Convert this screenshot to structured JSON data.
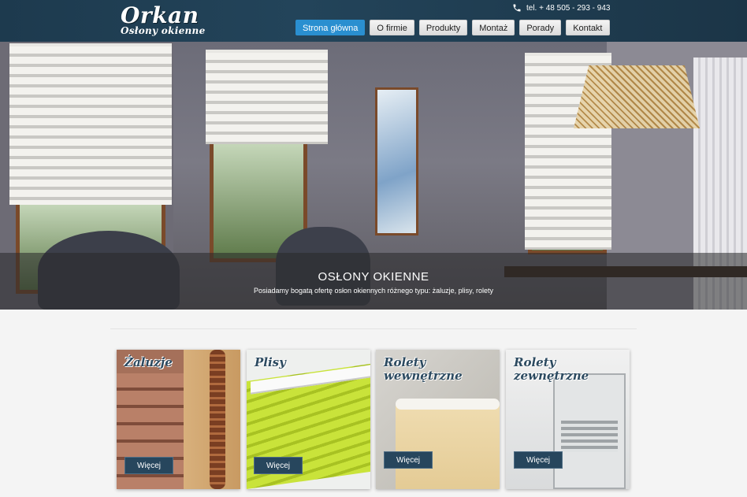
{
  "header": {
    "logo_title": "Orkan",
    "logo_subtitle": "Osłony okienne",
    "phone_label": "tel. + 48  505 - 293 - 943",
    "phone_icon": "phone-icon"
  },
  "nav": {
    "items": [
      {
        "label": "Strona główna",
        "active": true
      },
      {
        "label": "O firmie",
        "active": false
      },
      {
        "label": "Produkty",
        "active": false
      },
      {
        "label": "Montaż",
        "active": false
      },
      {
        "label": "Porady",
        "active": false
      },
      {
        "label": "Kontakt",
        "active": false
      }
    ]
  },
  "hero": {
    "title": "OSŁONY OKIENNE",
    "subtitle": "Posiadamy bogatą ofertę osłon okiennych różnego typu: żaluzje, plisy, rolety"
  },
  "products": [
    {
      "title": "Żaluzje",
      "button": "Więcej"
    },
    {
      "title": "Plisy",
      "button": "Więcej"
    },
    {
      "title": "Rolety\nwewnętrzne",
      "button": "Więcej"
    },
    {
      "title": "Rolety\nzewnętrzne",
      "button": "Więcej"
    }
  ],
  "colors": {
    "header_bg": "#1d3a4e",
    "nav_active": "#2a8fd0",
    "button_bg": "#27465d"
  }
}
